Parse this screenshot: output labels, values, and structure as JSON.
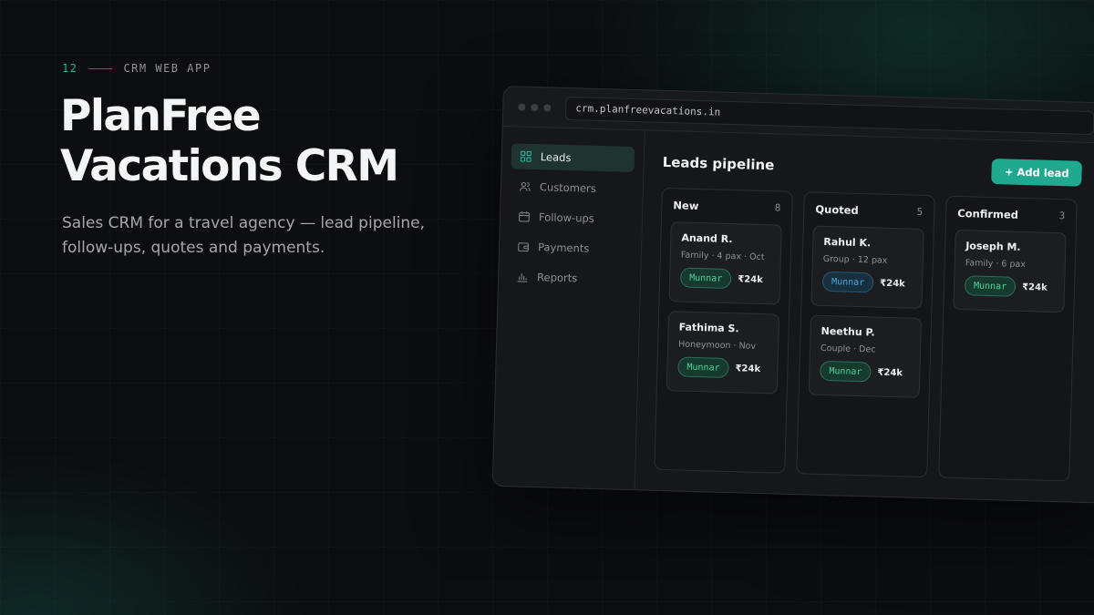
{
  "hero": {
    "number": "12",
    "eyebrow": "CRM WEB APP",
    "title": "PlanFree Vacations CRM",
    "subtitle": "Sales CRM for a travel agency — lead pipeline, follow-ups, quotes and payments."
  },
  "browser": {
    "url": "crm.planfreevacations.in"
  },
  "sidebar": {
    "items": [
      {
        "label": "Leads",
        "icon": "grid-icon",
        "active": true
      },
      {
        "label": "Customers",
        "icon": "users-icon"
      },
      {
        "label": "Follow-ups",
        "icon": "calendar-icon"
      },
      {
        "label": "Payments",
        "icon": "wallet-icon"
      },
      {
        "label": "Reports",
        "icon": "bar-chart-icon"
      }
    ]
  },
  "main": {
    "title": "Leads pipeline",
    "add_button": "+ Add lead"
  },
  "columns": [
    {
      "name": "New",
      "count": "8",
      "cards": [
        {
          "name": "Anand R.",
          "meta": "Family · 4 pax · Oct",
          "tag": "Munnar",
          "price": "₹24k"
        },
        {
          "name": "Fathima S.",
          "meta": "Honeymoon · Nov",
          "tag": "Munnar",
          "price": "₹24k"
        }
      ]
    },
    {
      "name": "Quoted",
      "count": "5",
      "cards": [
        {
          "name": "Rahul K.",
          "meta": "Group · 12 pax",
          "tag": "Munnar",
          "price": "₹24k"
        },
        {
          "name": "Neethu P.",
          "meta": "Couple · Dec",
          "tag": "Munnar",
          "price": "₹24k"
        }
      ]
    },
    {
      "name": "Confirmed",
      "count": "3",
      "cards": [
        {
          "name": "Joseph M.",
          "meta": "Family · 6 pax",
          "tag": "Munnar",
          "price": "₹24k"
        }
      ]
    }
  ],
  "colors": {
    "accent": "#1fa98f",
    "tag_green": "#48d49a",
    "tag_blue": "#46a9d8",
    "background": "#0c0d10"
  }
}
